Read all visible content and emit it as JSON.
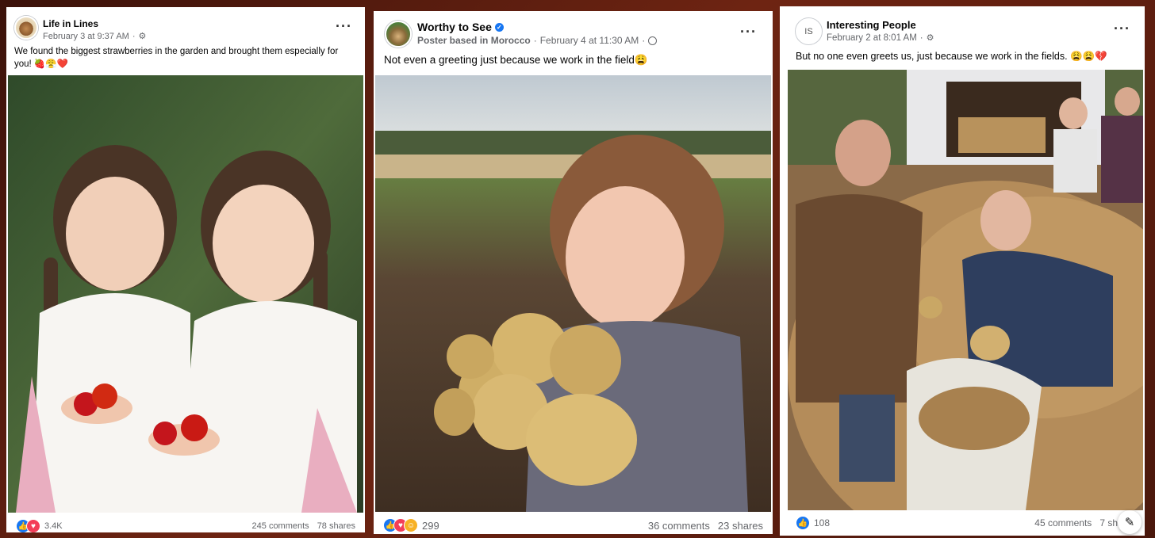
{
  "posts": [
    {
      "page_name": "Life in Lines",
      "timestamp": "February 3 at 9:37 AM",
      "audience_icon": "gear-icon",
      "text": "We found the biggest strawberries in the garden and brought them especially for you! 🍓😤❤️",
      "reactions": [
        "like",
        "love"
      ],
      "reaction_count": "3.4K",
      "comments": "245 comments",
      "shares": "78 shares",
      "image_subject": "two toddler girls in white dresses holding strawberries"
    },
    {
      "page_name": "Worthy to See",
      "verified": true,
      "subtitle": "Poster based in Morocco",
      "timestamp": "February 4 at 11:30 AM",
      "audience_icon": "globe-icon",
      "text": "Not even a greeting just because we work in the field😩",
      "reactions": [
        "like",
        "love",
        "care"
      ],
      "reaction_count": "299",
      "comments": "36 comments",
      "shares": "23 shares",
      "image_subject": "smiling girl holding potatoes in a field"
    },
    {
      "page_name": "Interesting People",
      "timestamp": "February 2 at 8:01 AM",
      "audience_icon": "gear-icon",
      "text": "But no one even greets us, just because we work in the fields. 😩😩💔",
      "reactions": [
        "like"
      ],
      "reaction_count": "108",
      "comments": "45 comments",
      "shares": "7 sh",
      "image_subject": "farmers with piles of potatoes and sacks"
    }
  ],
  "colors": {
    "background": "#5a1c0e",
    "like": "#1877f2",
    "love": "#f33e58",
    "care": "#f7b125",
    "meta_text": "#65676b"
  }
}
